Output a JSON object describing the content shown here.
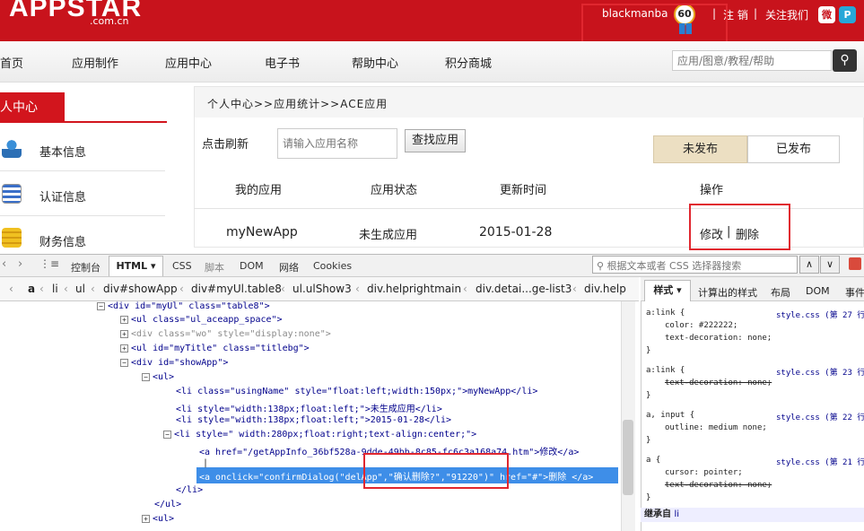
{
  "header": {
    "logo": "APPSTAR",
    "logo_sub": ".com.cn",
    "username": "blackmanba",
    "points": "60",
    "separator": "|",
    "logout": "注 销",
    "follow": "关注我们",
    "weibo_glyph": "微",
    "share_glyph": "P"
  },
  "nav": {
    "items": [
      "首页",
      "应用制作",
      "应用中心",
      "电子书",
      "帮助中心",
      "积分商城"
    ],
    "search_placeholder": "应用/图意/教程/帮助",
    "search_glyph": "⚲"
  },
  "sidebar": {
    "title": "个人中心",
    "items": [
      "基本信息",
      "认证信息",
      "财务信息"
    ]
  },
  "main": {
    "breadcrumb": "个人中心>>应用统计>>ACE应用",
    "refresh_label": "点击刷新",
    "input_placeholder": "请输入应用名称",
    "find_button": "查找应用",
    "tab_unpublished": "未发布",
    "tab_published": "已发布",
    "columns": [
      "我的应用",
      "应用状态",
      "更新时间",
      "操作"
    ],
    "row": {
      "app": "myNewApp",
      "status": "未生成应用",
      "time": "2015-01-28",
      "edit": "修改",
      "sep": "|",
      "delete": "删除"
    }
  },
  "devtools": {
    "tabs": [
      "控制台",
      "HTML",
      "CSS",
      "脚本",
      "DOM",
      "网络",
      "Cookies"
    ],
    "search_placeholder": "根据文本或者 CSS 选择器搜索",
    "up_glyph": "∧",
    "down_glyph": "∨",
    "crumbs": [
      "a",
      "li",
      "ul",
      "div#showApp",
      "div#myUl.table8",
      "ul.ulShow3",
      "div.helprightmain",
      "div.detai...ge-list3",
      "div.help"
    ],
    "right_tabs": [
      "样式",
      "计算出的样式",
      "布局",
      "DOM",
      "事件"
    ],
    "inherit_label": "继承自",
    "inherit_tag": "li"
  },
  "tree": [
    {
      "text": "<div id=\"myUl\" class=\"table8\">",
      "exp": "−"
    },
    {
      "text": "<ul class=\"ul_aceapp_space\">",
      "exp": "+"
    },
    {
      "text": "<div class=\"wo\" style=\"display:none\">",
      "exp": "+"
    },
    {
      "text": "<ul id=\"myTitle\" class=\"titlebg\">",
      "exp": "+"
    },
    {
      "text": "<div id=\"showApp\">",
      "exp": "−"
    },
    {
      "text": "<ul>",
      "exp": "−"
    },
    {
      "text": "<li class=\"usingName\" style=\"float:left;width:150px;\">myNewApp</li>",
      "exp": ""
    },
    {
      "text": "<li style=\"width:138px;float:left;\">未生成应用</li>",
      "exp": ""
    },
    {
      "text": "<li style=\"width:138px;float:left;\">2015-01-28</li>",
      "exp": ""
    },
    {
      "text": "<li style=\" width:280px;float:right;text-align:center;\">",
      "exp": "−"
    },
    {
      "text": "<a href=\"/getAppInfo_36bf528a-9dde-49bb-8c85-fc6c3a168a74.htm\">修改</a>",
      "exp": ""
    },
    {
      "text": "|",
      "exp": ""
    },
    {
      "text": "<a onclick=\"confirmDialog(\"delApp\",\"确认删除?\",\"91220\")\" href=\"#\">删除 </a>",
      "exp": ""
    },
    {
      "text": "</li>",
      "exp": ""
    },
    {
      "text": "</ul>",
      "exp": ""
    },
    {
      "text": "<ul>",
      "exp": "+"
    }
  ],
  "css_rules": [
    {
      "sel": "a:link {",
      "src": "style.css (第 27 行)",
      "props": [
        "color: #222222;",
        "text-decoration: none;"
      ],
      "strike": [
        false,
        false
      ]
    },
    {
      "sel": "a:link {",
      "src": "style.css (第 23 行)",
      "props": [
        "text-decoration: none;"
      ],
      "strike": [
        true
      ]
    },
    {
      "sel": "a, input {",
      "src": "style.css (第 22 行)",
      "props": [
        "outline: medium none;"
      ],
      "strike": [
        false
      ]
    },
    {
      "sel": "a {",
      "src": "style.css (第 21 行)",
      "props": [
        "cursor: pointer;",
        "text-decoration: none;"
      ],
      "strike": [
        false,
        true
      ]
    }
  ],
  "colors": {
    "brand_red": "#c8131c",
    "selection": "#3e8ee8",
    "highlight": "#e0272f"
  }
}
